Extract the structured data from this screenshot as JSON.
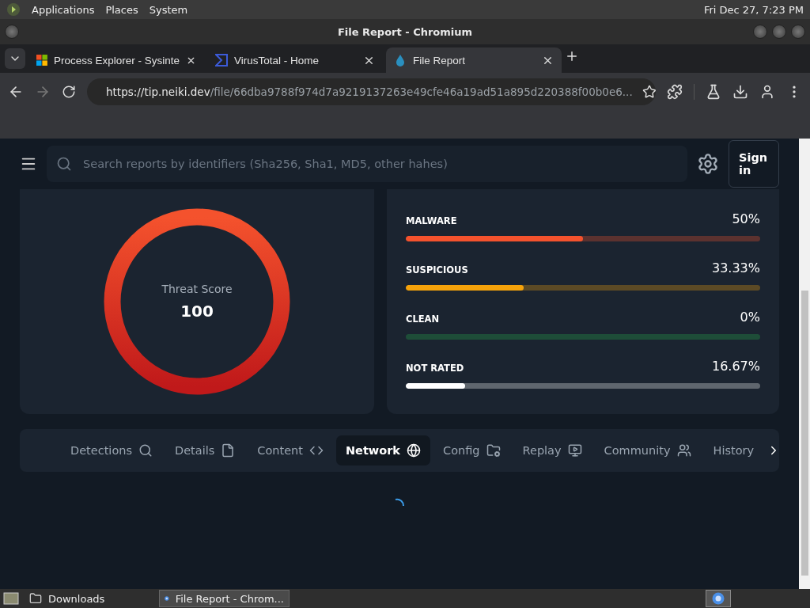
{
  "top_panel": {
    "menus": [
      "Applications",
      "Places",
      "System"
    ],
    "clock": "Fri Dec 27,  7:23 PM"
  },
  "window": {
    "title": "File Report - Chromium"
  },
  "browser_tabs": [
    {
      "title": "Process Explorer - Sysinte",
      "selected": false,
      "kind": "windows"
    },
    {
      "title": "VirusTotal - Home",
      "selected": false,
      "kind": "virustotal"
    },
    {
      "title": "File Report",
      "selected": true,
      "kind": "neiki"
    }
  ],
  "address_bar": {
    "host": "https://tip.neiki.dev",
    "path": "/file/66dba9788f974d7a9219137263e49cfe46a19ad51a895d220388f00b0e6..."
  },
  "site_header": {
    "search_placeholder": "Search reports by identifiers (Sha256, Sha1, MD5, other hahes)",
    "sign_in": "Sign in"
  },
  "threat_score": {
    "label": "Threat Score",
    "value": "100"
  },
  "verdicts": [
    {
      "label": "MALWARE",
      "reading": "50%",
      "level": 0.5,
      "color": "#f4522d"
    },
    {
      "label": "SUSPICIOUS",
      "reading": "33.33%",
      "level": 0.3333,
      "color": "#f5a20a"
    },
    {
      "label": "CLEAN",
      "reading": "0%",
      "level": 0,
      "color": "#1e4d38"
    },
    {
      "label": "NOT RATED",
      "reading": "16.67%",
      "level": 0.1667,
      "color": "#ffffff"
    }
  ],
  "report_tabs": [
    {
      "label": "Detections",
      "kind": "search",
      "selected": false
    },
    {
      "label": "Details",
      "kind": "file",
      "selected": false
    },
    {
      "label": "Content",
      "kind": "code",
      "selected": false
    },
    {
      "label": "Network",
      "kind": "globe",
      "selected": true
    },
    {
      "label": "Config",
      "kind": "folder",
      "selected": false
    },
    {
      "label": "Replay",
      "kind": "replay",
      "selected": false
    },
    {
      "label": "Community",
      "kind": "community",
      "selected": false
    },
    {
      "label": "History",
      "kind": "history",
      "selected": false
    }
  ],
  "taskbar": {
    "items": [
      {
        "label": "Downloads",
        "kind": "folder",
        "selected": false
      },
      {
        "label": "File Report - Chrom...",
        "kind": "chromium",
        "selected": true
      }
    ]
  }
}
